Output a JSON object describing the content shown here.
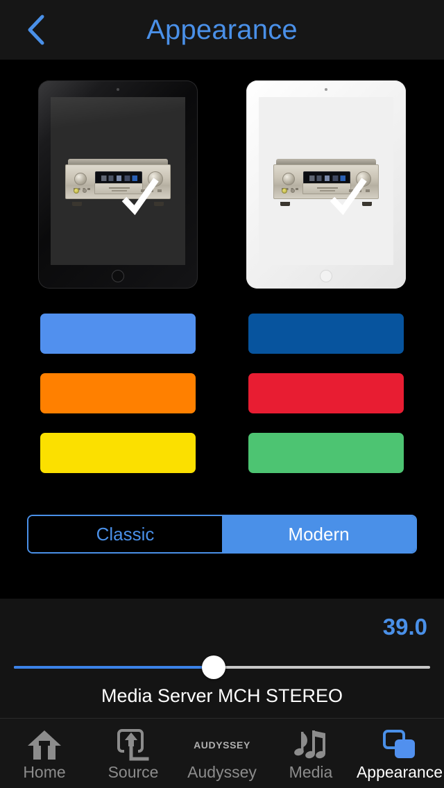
{
  "header": {
    "title": "Appearance",
    "back_icon": "chevron-left-icon",
    "accent": "#4a90e8",
    "background": "#161616"
  },
  "themes": [
    {
      "id": "dark",
      "name": "Dark Theme Tablet",
      "icon": "tablet-dark-preview",
      "selected": true,
      "device_color": "#1b1b1d",
      "screen_color": "#2b2b2b"
    },
    {
      "id": "light",
      "name": "Light Theme Tablet",
      "icon": "tablet-light-preview",
      "selected": true,
      "device_color": "#ffffff",
      "screen_color": "#f0f0f0"
    }
  ],
  "colors": [
    {
      "name": "light-blue",
      "hex": "#5190ee"
    },
    {
      "name": "dark-blue",
      "hex": "#07549e"
    },
    {
      "name": "orange",
      "hex": "#ff8000"
    },
    {
      "name": "red",
      "hex": "#e81d32"
    },
    {
      "name": "yellow",
      "hex": "#fbe000"
    },
    {
      "name": "green",
      "hex": "#4dc472"
    }
  ],
  "style_segmented": {
    "options": [
      {
        "label": "Classic",
        "selected": false
      },
      {
        "label": "Modern",
        "selected": true
      }
    ],
    "selected": "Modern",
    "accent": "#4a90e8"
  },
  "volume": {
    "value": "39.0",
    "percent": 48,
    "accent": "#4a90e8",
    "track_color": "#c8c8c8",
    "fill_color": "#3b82e8",
    "source_label": "Media Server  MCH STEREO"
  },
  "tabbar": {
    "items": [
      {
        "label": "Home",
        "icon": "home-icon",
        "active": false
      },
      {
        "label": "Source",
        "icon": "airplay-source-icon",
        "active": false
      },
      {
        "label": "Audyssey",
        "icon": "audyssey-logo-icon",
        "active": false,
        "logo_text": "AUDYSSEY"
      },
      {
        "label": "Media",
        "icon": "music-notes-icon",
        "active": false
      },
      {
        "label": "Appearance",
        "icon": "appearance-squares-icon",
        "active": true
      }
    ],
    "active_color": "#ffffff",
    "inactive_color": "#8c8c8c",
    "accent": "#4a90e8"
  }
}
